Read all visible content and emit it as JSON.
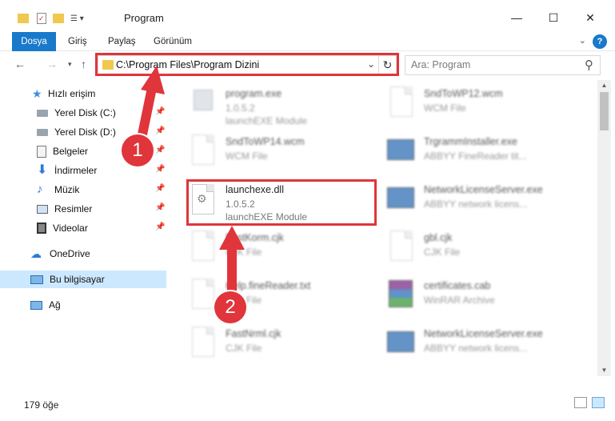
{
  "window": {
    "title": "Program",
    "minimize": "—",
    "maximize": "☐",
    "close": "✕"
  },
  "ribbon": {
    "tabs": [
      "Dosya",
      "Giriş",
      "Paylaş",
      "Görünüm"
    ],
    "help": "?"
  },
  "address_bar": {
    "path": "C:\\Program Files\\Program Dizini",
    "dropdown_icon": "chevron-down-icon",
    "refresh_icon": "refresh-icon"
  },
  "search": {
    "placeholder": "Ara: Program"
  },
  "sidebar": {
    "quick_access": "Hızlı erişim",
    "items": [
      {
        "label": "Yerel Disk (C:)",
        "icon": "drive-icon",
        "pinned": true
      },
      {
        "label": "Yerel Disk (D:)",
        "icon": "drive-icon",
        "pinned": true
      },
      {
        "label": "Belgeler",
        "icon": "documents-icon",
        "pinned": true
      },
      {
        "label": "İndirmeler",
        "icon": "download-icon",
        "pinned": true
      },
      {
        "label": "Müzik",
        "icon": "music-icon",
        "pinned": true
      },
      {
        "label": "Resimler",
        "icon": "pictures-icon",
        "pinned": true
      },
      {
        "label": "Videolar",
        "icon": "videos-icon",
        "pinned": true
      }
    ],
    "onedrive": "OneDrive",
    "this_pc": "Bu bilgisayar",
    "network": "Ağ"
  },
  "files": [
    {
      "name": "program.exe",
      "line2": "1.0.5.2",
      "line3": "launchEXE Module",
      "icon": "exe-icon",
      "blurred": true
    },
    {
      "name": "SndToWP12.wcm",
      "line2": "WCM File",
      "line3": "",
      "icon": "file-icon",
      "blurred": true
    },
    {
      "name": "SndToWP14.wcm",
      "line2": "WCM File",
      "line3": "",
      "icon": "file-icon",
      "blurred": true
    },
    {
      "name": "TrgrammInstaller.exe",
      "line2": "ABBYY FineReader tit...",
      "line3": "",
      "icon": "app-icon",
      "blurred": true
    },
    {
      "name": "launchexe.dll",
      "line2": "1.0.5.2",
      "line3": "launchEXE Module",
      "icon": "dll-icon",
      "blurred": false
    },
    {
      "name": "NetworkLicenseServer.exe",
      "line2": "ABBYY network licens...",
      "line3": "",
      "icon": "app-icon",
      "blurred": true
    },
    {
      "name": "FastKorm.cjk",
      "line2": "CJK File",
      "line3": "",
      "icon": "file-icon",
      "blurred": true
    },
    {
      "name": "gbl.cjk",
      "line2": "CJK File",
      "line3": "",
      "icon": "file-icon",
      "blurred": true
    },
    {
      "name": "Help.fineReader.txt",
      "line2": "TXT File",
      "line3": "",
      "icon": "file-icon",
      "blurred": true
    },
    {
      "name": "certificates.cab",
      "line2": "WinRAR Archive",
      "line3": "",
      "icon": "archive-icon",
      "blurred": true
    },
    {
      "name": "FastNrml.cjk",
      "line2": "CJK File",
      "line3": "",
      "icon": "file-icon",
      "blurred": true
    },
    {
      "name": "NetworkLicenseServer.exe",
      "line2": "ABBYY network licens...",
      "line3": "",
      "icon": "app-icon",
      "blurred": true
    }
  ],
  "status": {
    "item_count": "179 öğe"
  },
  "annotations": {
    "step1": "1",
    "step2": "2",
    "accent_color": "#e0353b"
  }
}
